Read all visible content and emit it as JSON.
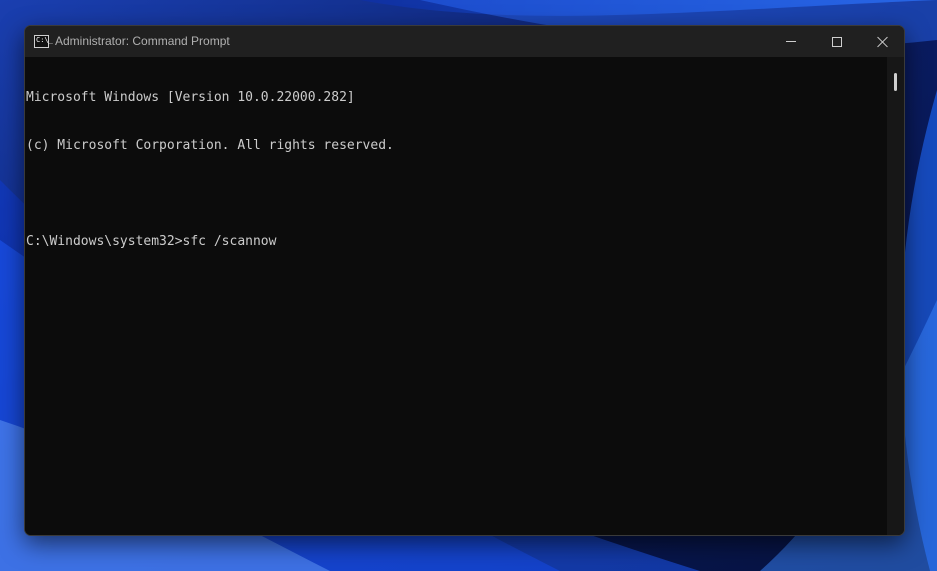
{
  "window": {
    "title": "Administrator: Command Prompt",
    "icon_text": "C:\\_",
    "controls": {
      "minimize_icon": "minimize-icon",
      "maximize_icon": "maximize-icon",
      "close_icon": "close-icon"
    }
  },
  "console": {
    "lines": [
      "Microsoft Windows [Version 10.0.22000.282]",
      "(c) Microsoft Corporation. All rights reserved.",
      "",
      "C:\\Windows\\system32>sfc /scannow"
    ],
    "text_color": "#cccccc",
    "background": "#0c0c0c"
  },
  "colors": {
    "titlebar": "#202020",
    "wallpaper_dark": "#071a5c",
    "wallpaper_accent": "#1f6bff"
  }
}
